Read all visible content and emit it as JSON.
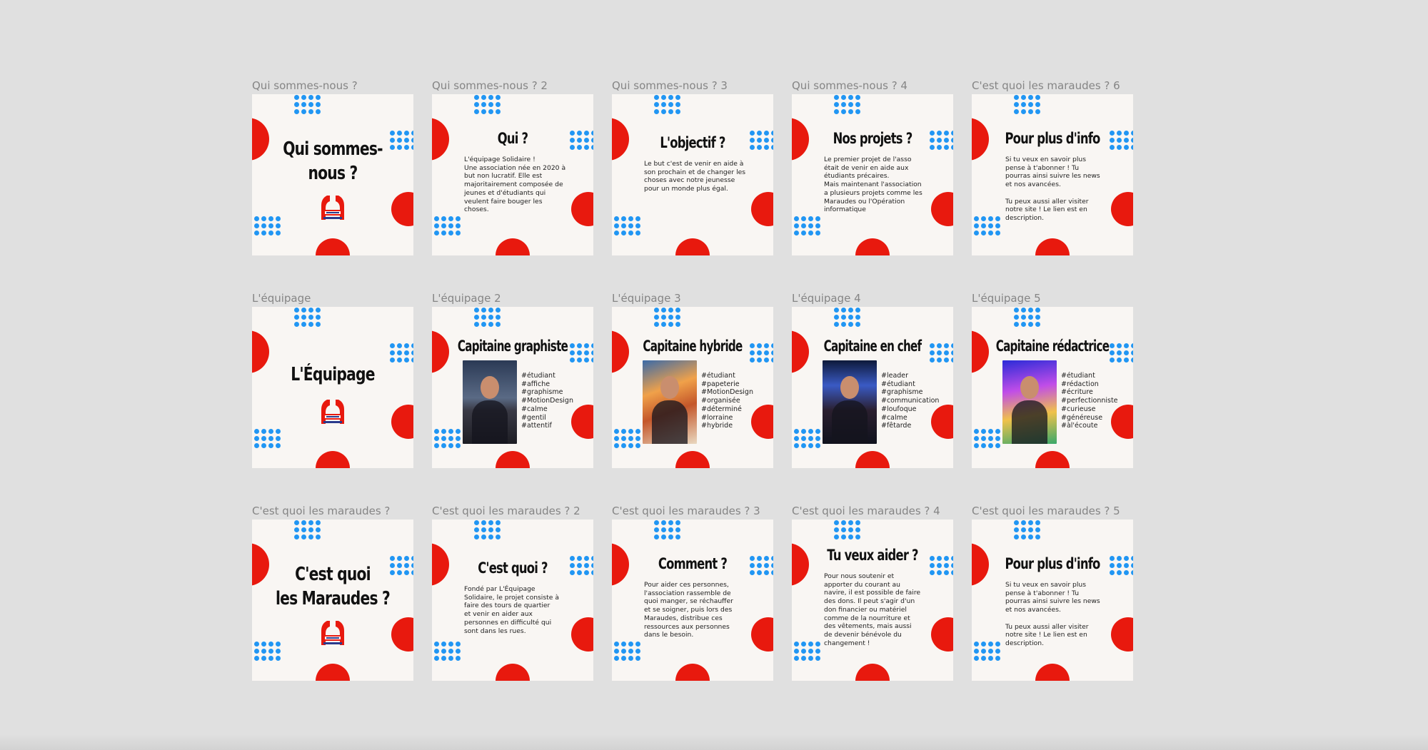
{
  "colors": {
    "canvas_bg": "#e0e0e0",
    "card_bg": "#f9f6f3",
    "accent_red": "#e8190e",
    "accent_blue": "#2196f3",
    "label_gray": "#858585"
  },
  "frames": [
    {
      "label": "Qui sommes-nous ?",
      "kind": "cover",
      "title": "Qui sommes-\nnous ?"
    },
    {
      "label": "Qui sommes-nous ? 2",
      "kind": "text",
      "title": "Qui ?",
      "text": "L'équipage Solidaire !\nUne association née en 2020 à\nbut non lucratif. Elle est\nmajoritairement composée de\njeunes et d'étudiants qui\nveulent faire bouger les\nchoses."
    },
    {
      "label": "Qui sommes-nous ? 3",
      "kind": "text",
      "title": "L'objectif ?",
      "text": "Le but c'est de venir en aide à\nson prochain et de changer les\nchoses avec notre jeunesse\npour un monde plus égal."
    },
    {
      "label": "Qui sommes-nous ? 4",
      "kind": "text",
      "title": "Nos projets ?",
      "text": "Le premier projet de l'asso\nétait de venir en aide aux\nétudiants précaires.\nMais maintenant l'association\na plusieurs projets comme les\nMaraudes ou l'Opération\ninformatique"
    },
    {
      "label": "C'est quoi les maraudes ? 6",
      "kind": "text",
      "title": "Pour plus d'info",
      "text": "Si tu veux en savoir plus\npense à t'abonner ! Tu\npourras ainsi suivre les news\net nos avancées.\n\nTu peux aussi aller visiter\nnotre site ! Le lien est en\ndescription."
    },
    {
      "label": "L'équipage",
      "kind": "cover",
      "title": "L'Équipage"
    },
    {
      "label": "L'équipage 2",
      "kind": "profile",
      "title": "Capitaine graphiste",
      "photo": "man-in-suit-photo",
      "tags": "#étudiant\n#affiche\n#graphisme\n#MotionDesign\n#calme\n#gentil\n#attentif"
    },
    {
      "label": "L'équipage 3",
      "kind": "profile",
      "title": "Capitaine hybride",
      "photo": "sunset-portrait-photo",
      "tags": "#étudiant\n#papeterie\n#MotionDesign\n#organisée\n#déterminé\n#lorraine\n#hybride"
    },
    {
      "label": "L'équipage 4",
      "kind": "profile",
      "title": "Capitaine en chef",
      "photo": "crowned-portrait-photo",
      "tags": "#leader\n#étudiant\n#graphisme\n#communication\n#loufoque\n#calme\n#fêtarde"
    },
    {
      "label": "L'équipage 5",
      "kind": "profile",
      "title": "Capitaine rédactrice",
      "photo": "neon-portrait-photo",
      "tags": "#étudiant\n#rédaction\n#écriture\n#perfectionniste\n#curieuse\n#généreuse\n#àl'écoute"
    },
    {
      "label": "C'est quoi les maraudes ?",
      "kind": "cover",
      "title": "C'est quoi\nles Maraudes ?"
    },
    {
      "label": "C'est quoi les maraudes ? 2",
      "kind": "text",
      "title": "C'est quoi ?",
      "text": "Fondé par L'Équipage\nSolidaire, le projet consiste à\nfaire des tours de quartier\net venir en aider aux\npersonnes en difficulté qui\nsont dans les rues."
    },
    {
      "label": "C'est quoi les maraudes ? 3",
      "kind": "text",
      "title": "Comment ?",
      "text": "Pour aider ces personnes,\nl'association rassemble de\nquoi manger, se réchauffer\net se soigner, puis lors des\nMaraudes, distribue ces\nressources aux personnes\ndans le besoin."
    },
    {
      "label": "C'est quoi les maraudes ? 4",
      "kind": "text",
      "title": "Tu veux aider ?",
      "text": "Pour nous soutenir et\napporter du courant au\nnavire, il est possible de faire\ndes dons. Il peut s'agir d'un\ndon financier ou matériel\ncomme de la nourriture et\ndes vêtements, mais aussi\nde devenir bénévole du\nchangement !"
    },
    {
      "label": "C'est quoi les maraudes ? 5",
      "kind": "text",
      "title": "Pour plus d'info",
      "text": "Si tu veux en savoir plus\npense à t'abonner ! Tu\npourras ainsi suivre les news\net nos avancées.\n\nTu peux aussi aller visiter\nnotre site ! Le lien est en\ndescription."
    }
  ]
}
